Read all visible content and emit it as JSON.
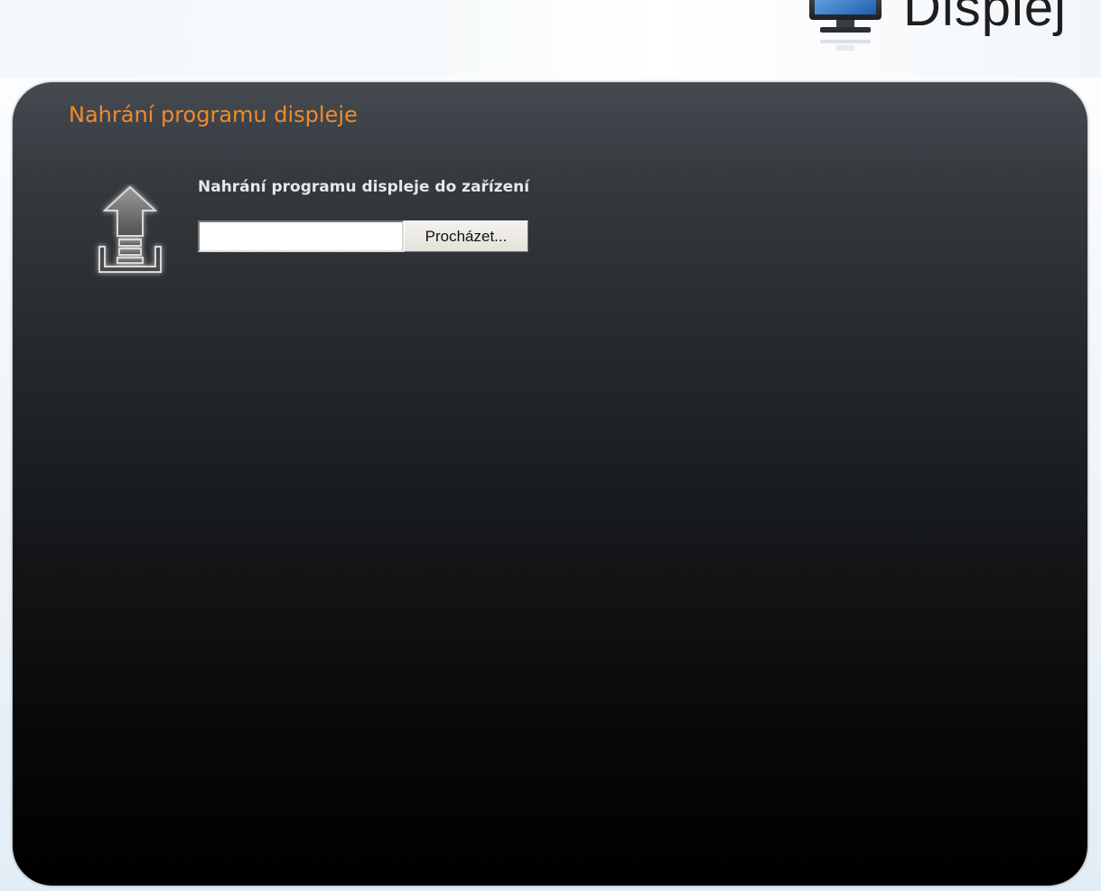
{
  "brand": {
    "title": "Displej",
    "icon": "monitor-icon"
  },
  "panel": {
    "title": "Nahrání programu displeje",
    "section_heading": "Nahrání programu displeje do zařízení",
    "upload_icon": "upload-arrow-icon",
    "file_input": {
      "value": "",
      "placeholder": ""
    },
    "browse_label": "Procházet..."
  },
  "colors": {
    "title_accent": "#f08a2c",
    "panel_top": "#454a51",
    "panel_bottom": "#000000"
  }
}
